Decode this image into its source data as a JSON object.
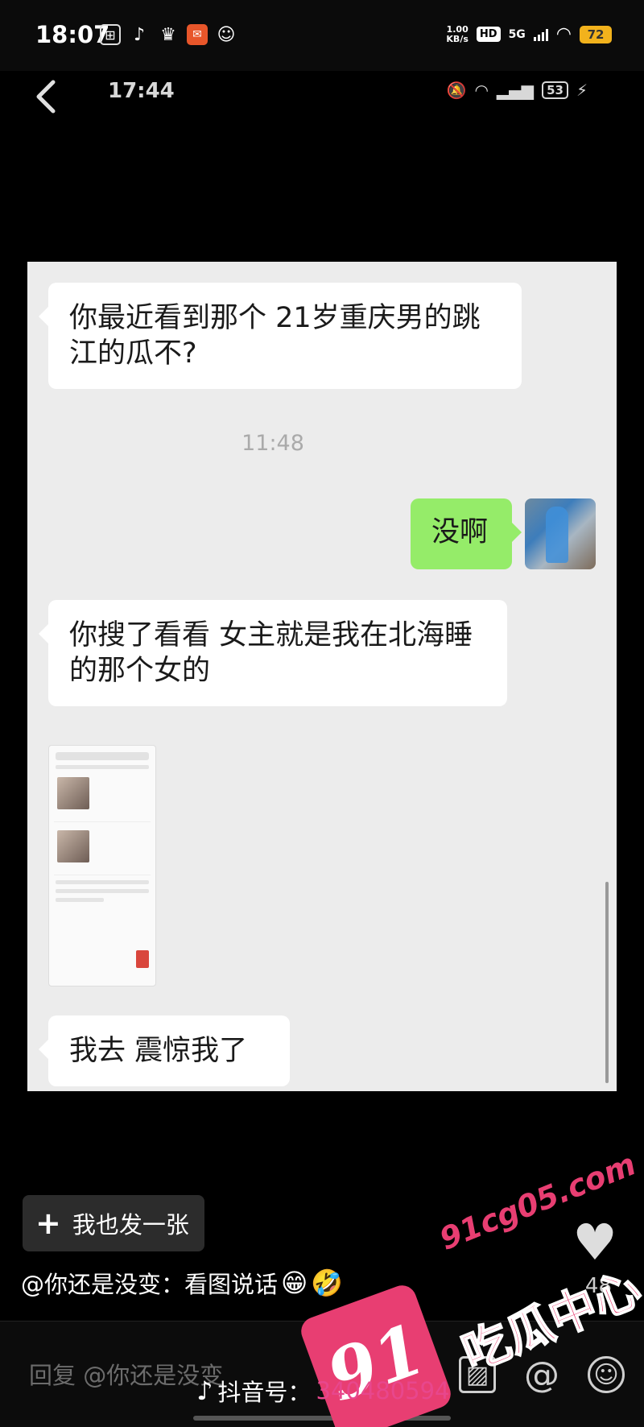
{
  "status_bar": {
    "time": "18:07",
    "speed_value": "1.00",
    "speed_unit": "KB/s",
    "hd": "HD",
    "network": "5G",
    "battery": "72"
  },
  "inner_status": {
    "time": "17:44",
    "battery": "53"
  },
  "chat": {
    "messages": [
      {
        "side": "left",
        "text": "你最近看到那个 21岁重庆男的跳江的瓜不?"
      },
      {
        "side": "time",
        "text": "11:48"
      },
      {
        "side": "right",
        "text": "没啊"
      },
      {
        "side": "left",
        "text": "你搜了看看   女主就是我在北海睡的那个女的"
      },
      {
        "side": "left",
        "type": "image"
      },
      {
        "side": "left",
        "text": "我去   震惊我了"
      }
    ]
  },
  "post_button": {
    "plus": "+",
    "label": "我也发一张"
  },
  "caption": {
    "text": "@你还是没变：看图说话",
    "emoji1": "😁",
    "emoji2": "🤣"
  },
  "like_count": "48",
  "reply": {
    "placeholder": "回复 @你还是没变"
  },
  "watermark": {
    "douyin_label": "抖音号：",
    "douyin_id": "340480594",
    "badge_number": "91",
    "url": "91cg05.com",
    "brand": "吃瓜中心"
  },
  "colors": {
    "chat_bg": "#ececec",
    "green_bubble": "#95ec69",
    "watermark_pink": "#e83e72",
    "battery": "#f2b21c"
  }
}
